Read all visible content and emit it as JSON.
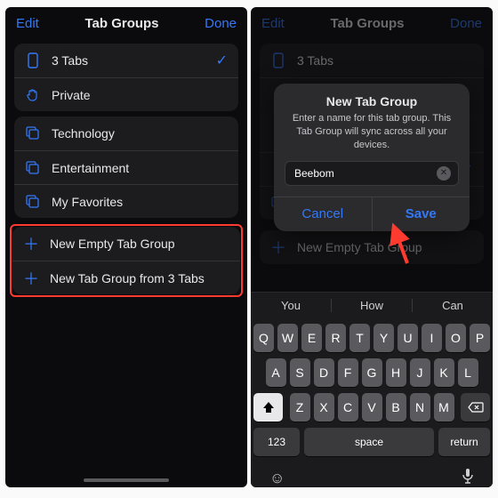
{
  "nav": {
    "edit": "Edit",
    "title": "Tab Groups",
    "done": "Done"
  },
  "tabs": {
    "tabs_label": "3 Tabs",
    "private_label": "Private"
  },
  "groups": [
    "Technology",
    "Entertainment",
    "My Favorites"
  ],
  "actions": {
    "new_empty": "New Empty Tab Group",
    "new_from": "New Tab Group from 3 Tabs"
  },
  "alert": {
    "title": "New Tab Group",
    "message": "Enter a name for this tab group. This Tab Group will sync across all your devices.",
    "value": "Beebom",
    "cancel": "Cancel",
    "save": "Save"
  },
  "predictive": [
    "You",
    "How",
    "Can"
  ],
  "kb": {
    "row1": [
      "Q",
      "W",
      "E",
      "R",
      "T",
      "Y",
      "U",
      "I",
      "O",
      "P"
    ],
    "row2": [
      "A",
      "S",
      "D",
      "F",
      "G",
      "H",
      "J",
      "K",
      "L"
    ],
    "row3": [
      "Z",
      "X",
      "C",
      "V",
      "B",
      "N",
      "M"
    ],
    "numeric": "123",
    "space": "space",
    "return": "return"
  }
}
